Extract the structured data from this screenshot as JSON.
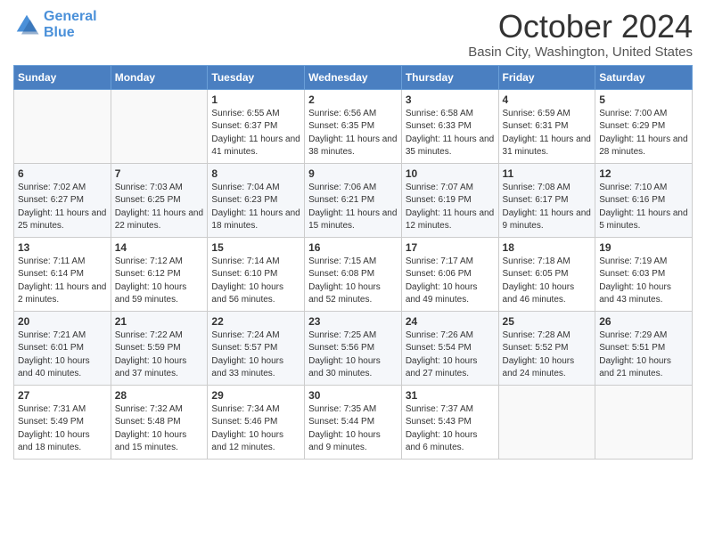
{
  "header": {
    "logo_line1": "General",
    "logo_line2": "Blue",
    "month_title": "October 2024",
    "location": "Basin City, Washington, United States"
  },
  "weekdays": [
    "Sunday",
    "Monday",
    "Tuesday",
    "Wednesday",
    "Thursday",
    "Friday",
    "Saturday"
  ],
  "weeks": [
    [
      {
        "day": "",
        "info": ""
      },
      {
        "day": "",
        "info": ""
      },
      {
        "day": "1",
        "info": "Sunrise: 6:55 AM\nSunset: 6:37 PM\nDaylight: 11 hours and 41 minutes."
      },
      {
        "day": "2",
        "info": "Sunrise: 6:56 AM\nSunset: 6:35 PM\nDaylight: 11 hours and 38 minutes."
      },
      {
        "day": "3",
        "info": "Sunrise: 6:58 AM\nSunset: 6:33 PM\nDaylight: 11 hours and 35 minutes."
      },
      {
        "day": "4",
        "info": "Sunrise: 6:59 AM\nSunset: 6:31 PM\nDaylight: 11 hours and 31 minutes."
      },
      {
        "day": "5",
        "info": "Sunrise: 7:00 AM\nSunset: 6:29 PM\nDaylight: 11 hours and 28 minutes."
      }
    ],
    [
      {
        "day": "6",
        "info": "Sunrise: 7:02 AM\nSunset: 6:27 PM\nDaylight: 11 hours and 25 minutes."
      },
      {
        "day": "7",
        "info": "Sunrise: 7:03 AM\nSunset: 6:25 PM\nDaylight: 11 hours and 22 minutes."
      },
      {
        "day": "8",
        "info": "Sunrise: 7:04 AM\nSunset: 6:23 PM\nDaylight: 11 hours and 18 minutes."
      },
      {
        "day": "9",
        "info": "Sunrise: 7:06 AM\nSunset: 6:21 PM\nDaylight: 11 hours and 15 minutes."
      },
      {
        "day": "10",
        "info": "Sunrise: 7:07 AM\nSunset: 6:19 PM\nDaylight: 11 hours and 12 minutes."
      },
      {
        "day": "11",
        "info": "Sunrise: 7:08 AM\nSunset: 6:17 PM\nDaylight: 11 hours and 9 minutes."
      },
      {
        "day": "12",
        "info": "Sunrise: 7:10 AM\nSunset: 6:16 PM\nDaylight: 11 hours and 5 minutes."
      }
    ],
    [
      {
        "day": "13",
        "info": "Sunrise: 7:11 AM\nSunset: 6:14 PM\nDaylight: 11 hours and 2 minutes."
      },
      {
        "day": "14",
        "info": "Sunrise: 7:12 AM\nSunset: 6:12 PM\nDaylight: 10 hours and 59 minutes."
      },
      {
        "day": "15",
        "info": "Sunrise: 7:14 AM\nSunset: 6:10 PM\nDaylight: 10 hours and 56 minutes."
      },
      {
        "day": "16",
        "info": "Sunrise: 7:15 AM\nSunset: 6:08 PM\nDaylight: 10 hours and 52 minutes."
      },
      {
        "day": "17",
        "info": "Sunrise: 7:17 AM\nSunset: 6:06 PM\nDaylight: 10 hours and 49 minutes."
      },
      {
        "day": "18",
        "info": "Sunrise: 7:18 AM\nSunset: 6:05 PM\nDaylight: 10 hours and 46 minutes."
      },
      {
        "day": "19",
        "info": "Sunrise: 7:19 AM\nSunset: 6:03 PM\nDaylight: 10 hours and 43 minutes."
      }
    ],
    [
      {
        "day": "20",
        "info": "Sunrise: 7:21 AM\nSunset: 6:01 PM\nDaylight: 10 hours and 40 minutes."
      },
      {
        "day": "21",
        "info": "Sunrise: 7:22 AM\nSunset: 5:59 PM\nDaylight: 10 hours and 37 minutes."
      },
      {
        "day": "22",
        "info": "Sunrise: 7:24 AM\nSunset: 5:57 PM\nDaylight: 10 hours and 33 minutes."
      },
      {
        "day": "23",
        "info": "Sunrise: 7:25 AM\nSunset: 5:56 PM\nDaylight: 10 hours and 30 minutes."
      },
      {
        "day": "24",
        "info": "Sunrise: 7:26 AM\nSunset: 5:54 PM\nDaylight: 10 hours and 27 minutes."
      },
      {
        "day": "25",
        "info": "Sunrise: 7:28 AM\nSunset: 5:52 PM\nDaylight: 10 hours and 24 minutes."
      },
      {
        "day": "26",
        "info": "Sunrise: 7:29 AM\nSunset: 5:51 PM\nDaylight: 10 hours and 21 minutes."
      }
    ],
    [
      {
        "day": "27",
        "info": "Sunrise: 7:31 AM\nSunset: 5:49 PM\nDaylight: 10 hours and 18 minutes."
      },
      {
        "day": "28",
        "info": "Sunrise: 7:32 AM\nSunset: 5:48 PM\nDaylight: 10 hours and 15 minutes."
      },
      {
        "day": "29",
        "info": "Sunrise: 7:34 AM\nSunset: 5:46 PM\nDaylight: 10 hours and 12 minutes."
      },
      {
        "day": "30",
        "info": "Sunrise: 7:35 AM\nSunset: 5:44 PM\nDaylight: 10 hours and 9 minutes."
      },
      {
        "day": "31",
        "info": "Sunrise: 7:37 AM\nSunset: 5:43 PM\nDaylight: 10 hours and 6 minutes."
      },
      {
        "day": "",
        "info": ""
      },
      {
        "day": "",
        "info": ""
      }
    ]
  ]
}
